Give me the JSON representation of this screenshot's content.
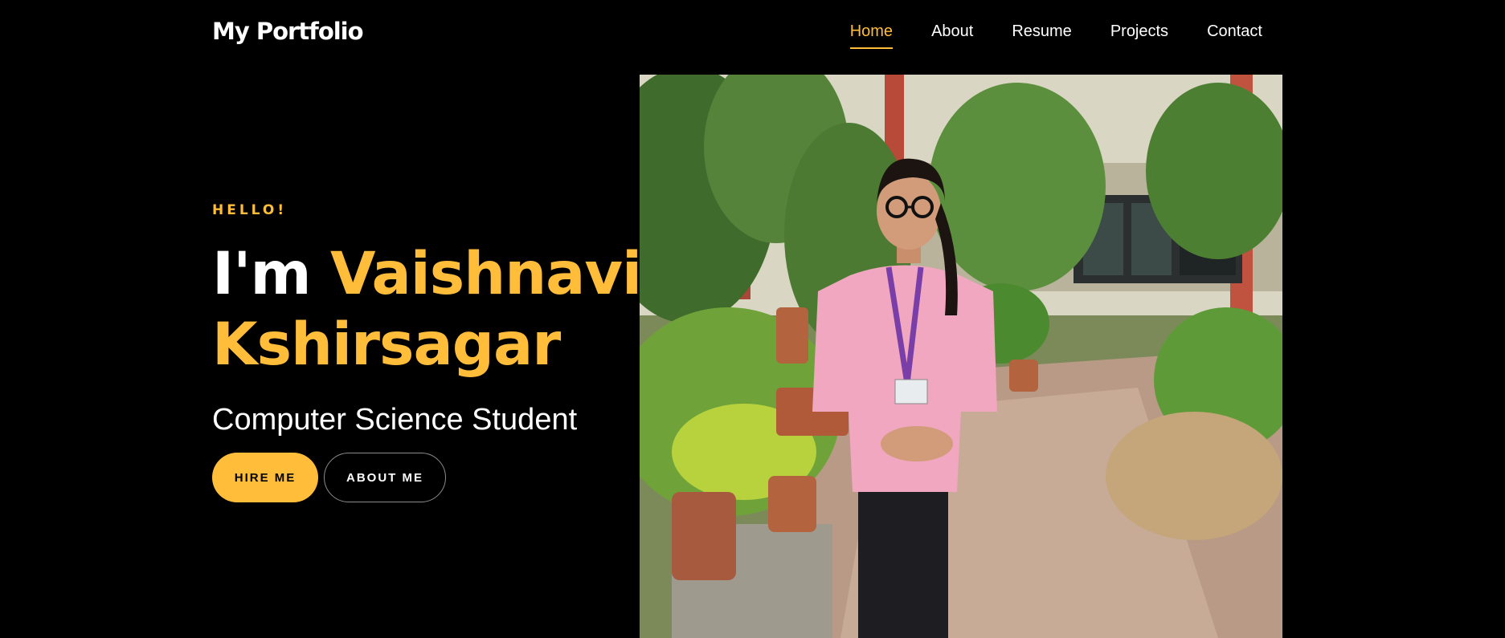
{
  "nav": {
    "logo": "My Portfolio",
    "links": [
      {
        "label": "Home",
        "active": true
      },
      {
        "label": "About",
        "active": false
      },
      {
        "label": "Resume",
        "active": false
      },
      {
        "label": "Projects",
        "active": false
      },
      {
        "label": "Contact",
        "active": false
      }
    ]
  },
  "hero": {
    "greeting": "HELLO!",
    "name_prefix": "I'm",
    "first_name": "Vaishnavi",
    "last_name": "Kshirsagar",
    "subtitle": "Computer Science Student",
    "hire_button": "HIRE ME",
    "about_button": "ABOUT ME"
  },
  "colors": {
    "background": "#000000",
    "accent": "#ffbd39",
    "text": "#ffffff"
  }
}
